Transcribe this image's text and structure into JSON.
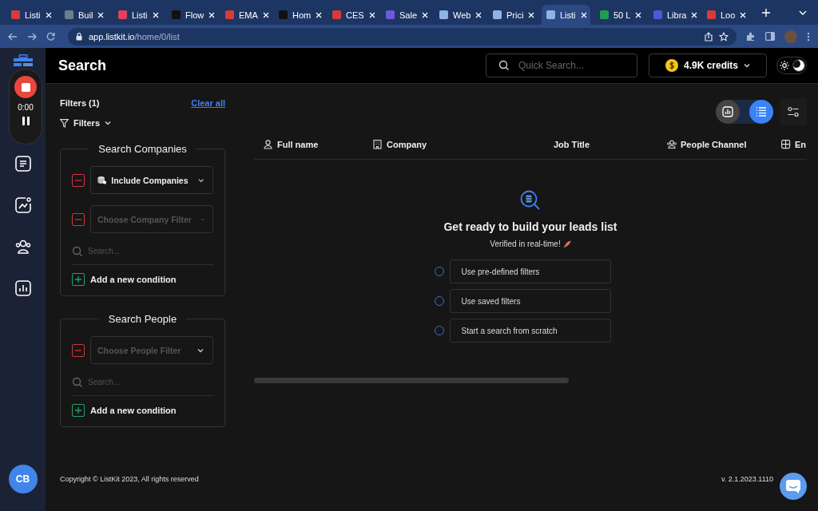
{
  "browser": {
    "tabs": [
      {
        "title": "Listi",
        "selected": false,
        "color": "#d93a3a"
      },
      {
        "title": "Buil",
        "selected": false,
        "color": "#6b7f8f"
      },
      {
        "title": "Listi",
        "selected": false,
        "color": "#e0405a"
      },
      {
        "title": "Flow",
        "selected": false,
        "color": "#111111"
      },
      {
        "title": "EMA",
        "selected": false,
        "color": "#d93a3a"
      },
      {
        "title": "Hom",
        "selected": false,
        "color": "#111111"
      },
      {
        "title": "CES",
        "selected": false,
        "color": "#d93a3a"
      },
      {
        "title": "Sale",
        "selected": false,
        "color": "#6a5ad8"
      },
      {
        "title": "Web",
        "selected": false,
        "color": "#8fb3e8"
      },
      {
        "title": "Prici",
        "selected": false,
        "color": "#8fb3e8"
      },
      {
        "title": "Listi",
        "selected": true,
        "color": "#8fb3e8"
      },
      {
        "title": "50 L",
        "selected": false,
        "color": "#1e9e50"
      },
      {
        "title": "Libra",
        "selected": false,
        "color": "#4a5ad8"
      },
      {
        "title": "Loo",
        "selected": false,
        "color": "#d93a3a"
      }
    ],
    "address": {
      "host": "app.listkit.io",
      "path": "/home/0/list"
    }
  },
  "recorder": {
    "time": "0:00"
  },
  "sidebar": {
    "avatar": "CB"
  },
  "header": {
    "title": "Search",
    "search": {
      "placeholder": "Quick Search..."
    },
    "credits": "4.9K credits",
    "theme": {
      "dark": true
    }
  },
  "filters": {
    "title": "Filters (1)",
    "clear": "Clear all",
    "toggle": "Filters",
    "sections": [
      {
        "title": "Search Companies",
        "rows": [
          {
            "value": "Include Companies"
          },
          {
            "placeholder": "Choose Company Filter"
          }
        ],
        "search": {
          "placeholder": "Search..."
        },
        "add": "Add a new condition"
      },
      {
        "title": "Search People",
        "rows": [
          {
            "placeholder": "Choose People Filter"
          }
        ],
        "search": {
          "placeholder": "Search..."
        },
        "add": "Add a new condition"
      }
    ]
  },
  "main": {
    "view_toggle": [
      {
        "kind": "chart",
        "selected": false
      },
      {
        "kind": "list",
        "selected": true
      }
    ],
    "columns": [
      {
        "kind": "person",
        "label": "Full name"
      },
      {
        "kind": "building",
        "label": "Company"
      },
      {
        "kind": "none",
        "label": "Job Title"
      },
      {
        "kind": "people",
        "label": "People Channel"
      },
      {
        "kind": "grid",
        "label": "En"
      }
    ],
    "empty": {
      "title": "Get ready to build your leads list",
      "subtitle": "Verified in real-time!",
      "options": [
        {
          "label": "Use pre-defined filters",
          "selected": false
        },
        {
          "label": "Use saved filters",
          "selected": false
        },
        {
          "label": "Start a search from scratch",
          "selected": false
        }
      ]
    }
  },
  "footer": {
    "copyright": "Copyright © ListKit 2023, All rights reserved",
    "version": "v. 2.1.2023.1110"
  }
}
